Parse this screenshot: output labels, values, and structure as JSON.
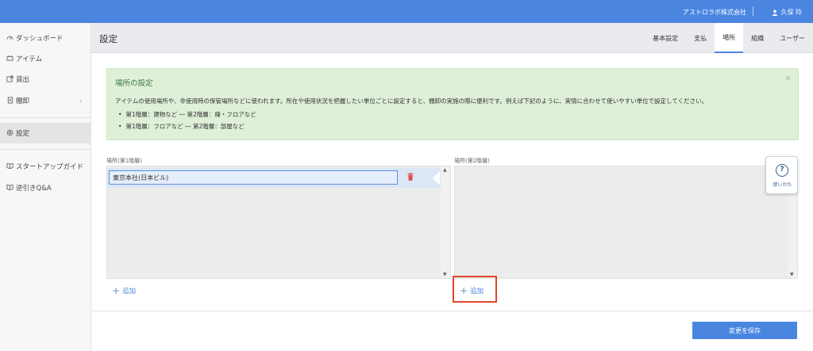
{
  "topbar": {
    "company": "アストロラボ株式会社",
    "user_name": "久保 玲"
  },
  "sidebar": {
    "items": [
      {
        "label": "ダッシュボード",
        "icon": "dashboard-icon"
      },
      {
        "label": "アイテム",
        "icon": "item-icon"
      },
      {
        "label": "貸出",
        "icon": "lend-icon"
      },
      {
        "label": "棚卸",
        "icon": "inventory-icon"
      },
      {
        "label": "設定",
        "icon": "settings-icon"
      },
      {
        "label": "スタートアップガイド",
        "icon": "book-icon"
      },
      {
        "label": "逆引きQ&A",
        "icon": "book-icon"
      }
    ]
  },
  "header": {
    "title": "設定",
    "tabs": [
      {
        "label": "基本設定"
      },
      {
        "label": "支払"
      },
      {
        "label": "場所"
      },
      {
        "label": "組織"
      },
      {
        "label": "ユーザー"
      }
    ],
    "active_tab": "場所"
  },
  "info": {
    "title": "場所の設定",
    "description": "アイテムの使用場所や、非使用時の保管場所などに使われます。所在や使用状況を把握したい単位ごとに設定すると、棚卸の実施の際に便利です。例えば下記のように、実情に合わせて使いやすい単位で設定してください。",
    "examples": [
      "第1階層：建物など ― 第2階層：棟・フロアなど",
      "第1階層：フロアなど ― 第2階層：部屋など"
    ]
  },
  "locations": {
    "level1_label": "場所(第1階層)",
    "level2_label": "場所(第2階層)",
    "level1_items": [
      {
        "value": "東京本社(日本ビル)"
      }
    ],
    "add_label": "追加"
  },
  "help": {
    "label": "使いかた"
  },
  "footer": {
    "save_label": "変更を保存"
  },
  "colors": {
    "primary": "#4a86e0",
    "info_bg": "#dff0d8",
    "info_title": "#3c763d",
    "delete": "#e05050",
    "highlight": "#e0462b"
  }
}
